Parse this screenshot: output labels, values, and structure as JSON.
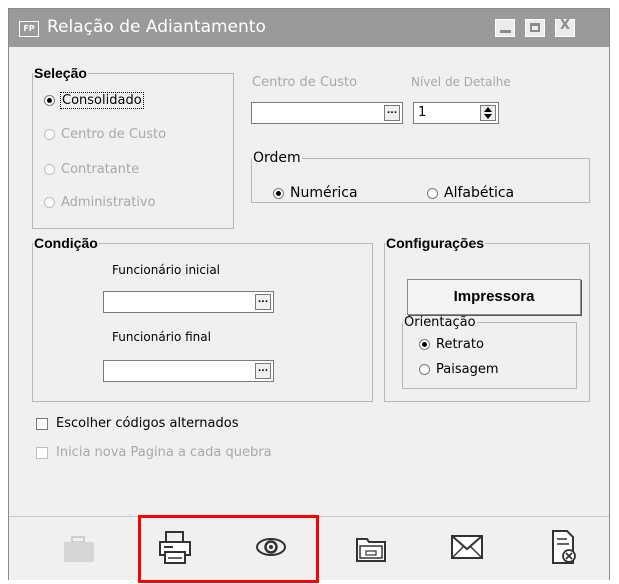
{
  "window": {
    "title": "Relação de Adiantamento",
    "badge": "FP",
    "controls": {
      "minimize": "_",
      "maximize": "□",
      "close": "X"
    }
  },
  "selecao": {
    "legend": "Seleção",
    "options": [
      "Consolidado",
      "Centro de Custo",
      "Contratante",
      "Administrativo"
    ],
    "selected": "Consolidado"
  },
  "centro_custo": {
    "label": "Centro de Custo",
    "value": "",
    "button": "..."
  },
  "nivel_detalhe": {
    "label": "Nível de Detalhe",
    "value": "1"
  },
  "ordem": {
    "legend": "Ordem",
    "options": [
      "Numérica",
      "Alfabética"
    ],
    "selected": "Numérica"
  },
  "condicao": {
    "legend": "Condição",
    "funcionario_inicial": {
      "label": "Funcionário inicial",
      "value": "",
      "button": "..."
    },
    "funcionario_final": {
      "label": "Funcionário final",
      "value": "",
      "button": "..."
    }
  },
  "configuracoes": {
    "legend": "Configurações",
    "impressora_button": "Impressora",
    "orientacao": {
      "legend": "Orientação",
      "options": [
        "Retrato",
        "Paisagem"
      ],
      "selected": "Retrato"
    }
  },
  "checkboxes": {
    "escolher_codigos": {
      "label": "Escolher códigos alternados",
      "checked": false
    },
    "inicia_nova_pagina": {
      "label": "Inicia nova Pagina a cada quebra",
      "checked": false,
      "disabled": true
    }
  },
  "toolbar": {
    "items": [
      "briefcase-icon",
      "printer-icon",
      "preview-eye-icon",
      "folder-icon",
      "envelope-icon",
      "document-close-icon"
    ],
    "highlight_color": "#ff0000"
  }
}
